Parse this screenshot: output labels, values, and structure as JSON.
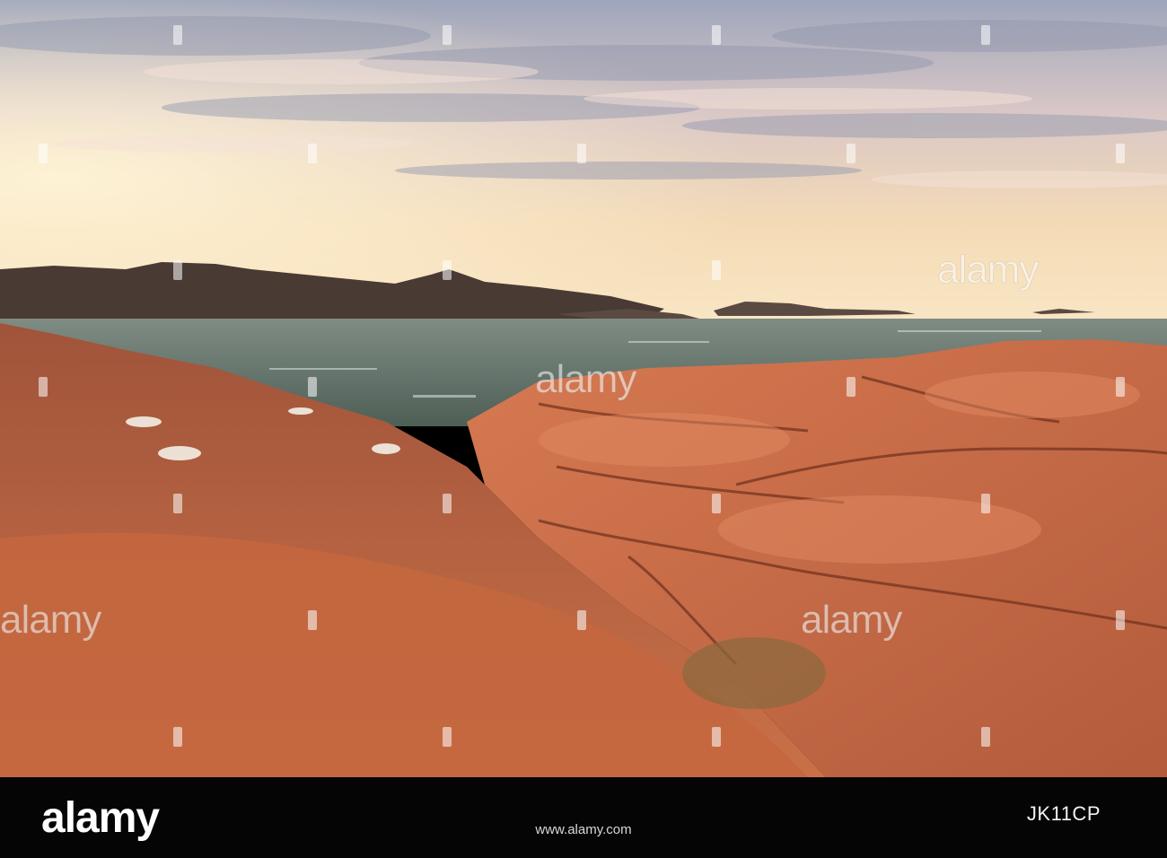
{
  "watermark": {
    "text": "alamy",
    "color": "#ffffff"
  },
  "footer": {
    "brand": "alamy",
    "url": "www.alamy.com",
    "image_id": "JK11CP",
    "background": "#050505"
  },
  "scene": {
    "subject": "coastal granite rocks at sunset",
    "colors": {
      "sky_top": "#a9aebf",
      "sky_glow": "#f7dcb3",
      "sea": "#5e7064",
      "rock_light": "#c66c48",
      "rock_dark": "#7a3a25"
    }
  }
}
